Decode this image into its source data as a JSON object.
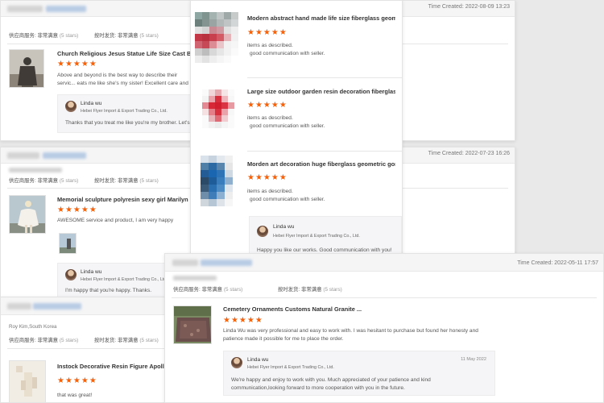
{
  "labels": {
    "supplier_service": "供应商服务:",
    "on_time_shipping": "按时发货:",
    "very_satisfied": "非常满意",
    "five_stars": "(5 stars)",
    "time_created_prefix": "Time Created:",
    "star_glyphs": "★★★★★"
  },
  "review1": {
    "time": "2022-08-09 13:23",
    "title": "Church Religious Jesus Statue Life Size Cast B...",
    "text": "Above and beyond is the best way to describe their servic... eats me like she's my sister! Excellent care and an advoca...",
    "reply_name": "Linda wu",
    "reply_company": "Hebei Flyer Import & Export Trading Co., Ltd.",
    "reply_text": "Thanks that you treat me like you're my brother. Let's g..."
  },
  "review2": {
    "time": "2022-07-23 16:26",
    "title": "Memorial sculpture polyresin sexy girl Marilyn ...",
    "text": "AWESOME service and product, I am very happy",
    "reply_name": "Linda wu",
    "reply_company": "Hebei Flyer Import & Export Trading Co., Ltd.",
    "reply_text": "I'm happy that you're happy. Thanks."
  },
  "review3": {
    "location": "Roy Kim,South Korea",
    "title": "Instock Decorative Resin Figure Apollo Bu...",
    "text": "that was great!"
  },
  "popup": {
    "items": [
      {
        "title": "Modern abstract hand made life size fiberglass geom...",
        "line1": "items as described.",
        "line2": "good communication with seller."
      },
      {
        "title": "Large size outdoor garden resin decoration fiberglass...",
        "line1": "items as described.",
        "line2": "good communication with seller."
      },
      {
        "title": "Morden art decoration huge fiberglass geometric gori...",
        "line1": "items as described.",
        "line2": "good communication with seller."
      }
    ],
    "reply_name": "Linda wu",
    "reply_company": "Hebei Flyer Import & Export Trading Co., Ltd.",
    "reply_text": "Happy you like our works. Good communication with you!"
  },
  "review4": {
    "time": "2022-05-11 17:57",
    "title": "Cemetery Ornaments Customs Natural Granite ...",
    "text": "Linda Wu was very professional and easy to work with. I was hesitant to purchase but found her honesty and patience made it possible for me to place the order.",
    "reply_name": "Linda wu",
    "reply_company": "Hebei Flyer Import & Export Trading Co., Ltd.",
    "reply_date": "11 May 2022",
    "reply_text": "We're happy and enjoy to work with you. Much appreciated of your patience and kind communication,looking forward to more cooperation with you in the future."
  },
  "colors": {
    "star": "#f2620f",
    "reply_bg": "#f5f5f7",
    "header_bg": "#f5f5f5"
  }
}
